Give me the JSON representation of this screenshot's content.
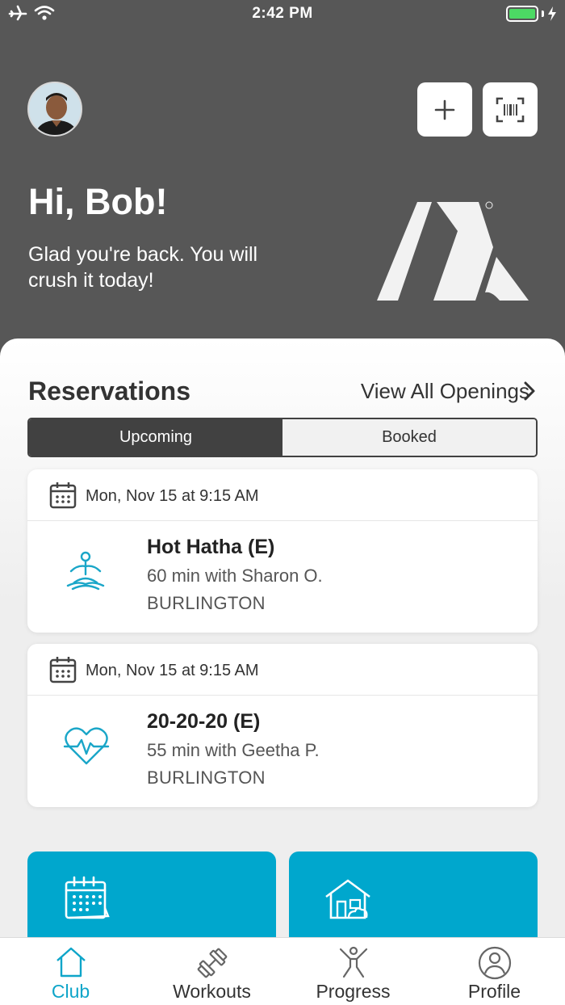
{
  "status_bar": {
    "time": "2:42 PM"
  },
  "header": {
    "greeting": "Hi, Bob!",
    "subtitle": "Glad you're back. You will crush it today!",
    "buttons": {
      "add_icon": "plus-icon",
      "scan_icon": "barcode-scan-icon"
    }
  },
  "reservations": {
    "title": "Reservations",
    "view_all": "View All Openings",
    "tabs": [
      {
        "label": "Upcoming",
        "active": true
      },
      {
        "label": "Booked",
        "active": false
      }
    ],
    "items": [
      {
        "date": "Mon, Nov 15 at 9:15 AM",
        "name": "Hot Hatha (E)",
        "meta": "60 min with Sharon O.",
        "location": "BURLINGTON",
        "icon": "yoga-icon"
      },
      {
        "date": "Mon, Nov 15 at 9:15 AM",
        "name": "20-20-20 (E)",
        "meta": "55 min with Geetha P.",
        "location": "BURLINGTON",
        "icon": "heart-pulse-icon"
      }
    ]
  },
  "tiles": [
    {
      "icon": "calendar-icon"
    },
    {
      "icon": "home-icon"
    }
  ],
  "tabbar": [
    {
      "label": "Club",
      "icon": "home-outline-icon",
      "active": true
    },
    {
      "label": "Workouts",
      "icon": "dumbbell-icon",
      "active": false
    },
    {
      "label": "Progress",
      "icon": "person-jump-icon",
      "active": false
    },
    {
      "label": "Profile",
      "icon": "user-circle-icon",
      "active": false
    }
  ],
  "colors": {
    "header_bg": "#575757",
    "accent": "#00a7cd",
    "tab_active": "#0ea5c9",
    "battery": "#4cd964"
  }
}
